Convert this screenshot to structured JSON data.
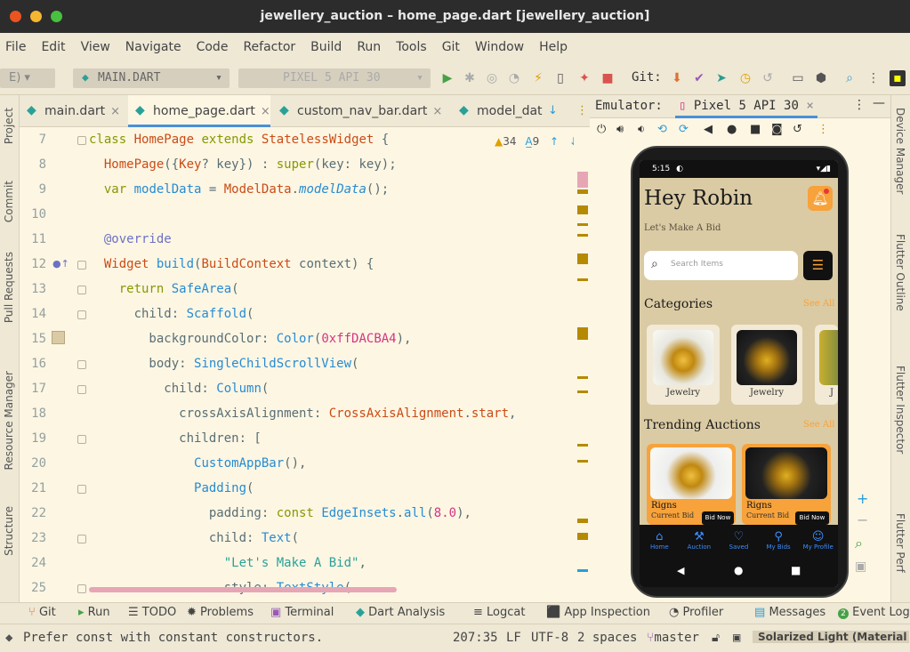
{
  "window": {
    "title": "jewellery_auction – home_page.dart [jewellery_auction]"
  },
  "menu": [
    "File",
    "Edit",
    "View",
    "Navigate",
    "Code",
    "Refactor",
    "Build",
    "Run",
    "Tools",
    "Git",
    "Window",
    "Help"
  ],
  "toolbar": {
    "config_combo": "MAIN.DART",
    "device_combo": "PIXEL 5 API 30",
    "git_label": "Git:"
  },
  "tabs": [
    "main.dart",
    "home_page.dart",
    "custom_nav_bar.dart",
    "model_dat"
  ],
  "active_tab": "home_page.dart",
  "left_tools": [
    "Project",
    "Commit",
    "Pull Requests",
    "Resource Manager",
    "Structure"
  ],
  "right_tools": [
    "Device Manager",
    "Flutter Outline",
    "Flutter Inspector",
    "Flutter Perf"
  ],
  "inspection": {
    "warnings": "34",
    "typos": "9"
  },
  "line_numbers": [
    "7",
    "8",
    "9",
    "10",
    "11",
    "12",
    "13",
    "14",
    "15",
    "16",
    "17",
    "18",
    "19",
    "20",
    "21",
    "22",
    "23",
    "24",
    "25"
  ],
  "emulator": {
    "label": "Emulator:",
    "device_tab": "Pixel 5 API 30"
  },
  "app": {
    "time": "5:15",
    "greeting": "Hey Robin",
    "subtitle": "Let's Make A Bid",
    "search_placeholder": "Search Items",
    "categories_title": "Categories",
    "see_all": "See All",
    "categories": [
      "Jewelry",
      "Jewelry",
      "J"
    ],
    "trending_title": "Trending Auctions",
    "trending": [
      {
        "name": "Rigns",
        "sub": "Current Bid",
        "button": "Bid Now"
      },
      {
        "name": "Rigns",
        "sub": "Current Bid",
        "button": "Bid Now"
      }
    ],
    "nav": [
      "Home",
      "Auction",
      "Saved",
      "My Bids",
      "My Profile"
    ],
    "background_color": "#DACBA4",
    "accent_color": "#F7A23B"
  },
  "bottom_tools": [
    "Git",
    "Run",
    "TODO",
    "Problems",
    "Terminal",
    "Dart Analysis",
    "Logcat",
    "App Inspection",
    "Profiler",
    "Messages",
    "Event Log"
  ],
  "event_count": "2",
  "status": {
    "message": "Prefer const with constant constructors.",
    "position": "207:35",
    "line_sep": "LF",
    "encoding": "UTF-8",
    "indent": "2 spaces",
    "branch": "master",
    "theme": "Solarized Light (Material"
  }
}
